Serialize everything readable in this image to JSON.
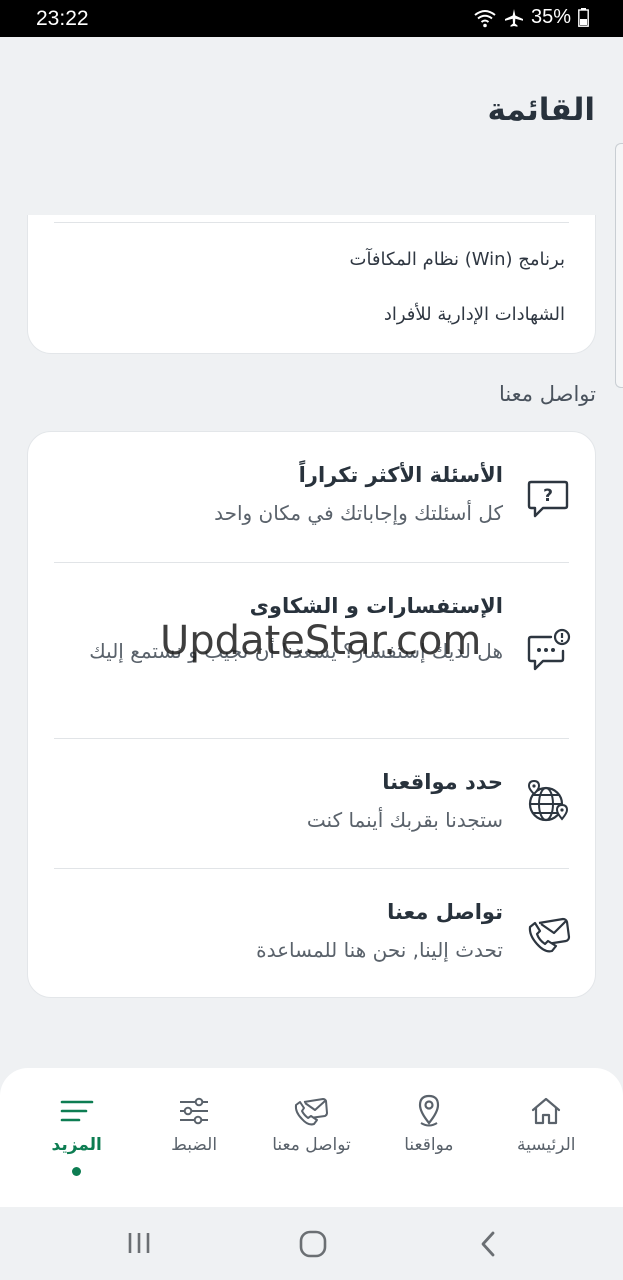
{
  "status_bar": {
    "time": "23:22",
    "battery": "35%"
  },
  "header": {
    "title": "القائمة"
  },
  "top_card": {
    "items": [
      {
        "label": "برنامج (Win) نظام المكافآت"
      },
      {
        "label": "الشهادات الإدارية للأفراد"
      }
    ]
  },
  "contact_section": {
    "label": "تواصل معنا",
    "items": [
      {
        "title": "الأسئلة الأكثر تكراراً",
        "subtitle": "كل أسئلتك وإجاباتك في مكان واحد",
        "icon": "faq-chat-icon"
      },
      {
        "title": "الإستفسارات و الشكاوى",
        "subtitle": "هل لديك إستفسار؟ يسعدنا أن نجيب و نستمع إليك",
        "icon": "complaint-chat-icon"
      },
      {
        "title": "حدد مواقعنا",
        "subtitle": "ستجدنا بقربك أينما كنت",
        "icon": "globe-location-icon"
      },
      {
        "title": "تواصل معنا",
        "subtitle": "تحدث إلينا, نحن هنا للمساعدة",
        "icon": "phone-mail-icon"
      }
    ]
  },
  "watermark": "UpdateStar.com",
  "bottom_nav": {
    "items": [
      {
        "label": "الرئيسية",
        "icon": "home-icon"
      },
      {
        "label": "مواقعنا",
        "icon": "location-pin-icon"
      },
      {
        "label": "تواصل معنا",
        "icon": "phone-mail-icon"
      },
      {
        "label": "الضبط",
        "icon": "sliders-icon"
      },
      {
        "label": "المزيد",
        "icon": "menu-icon",
        "active": true
      }
    ]
  },
  "colors": {
    "accent": "#0d7d52",
    "background": "#eff1f3",
    "card": "#ffffff"
  }
}
